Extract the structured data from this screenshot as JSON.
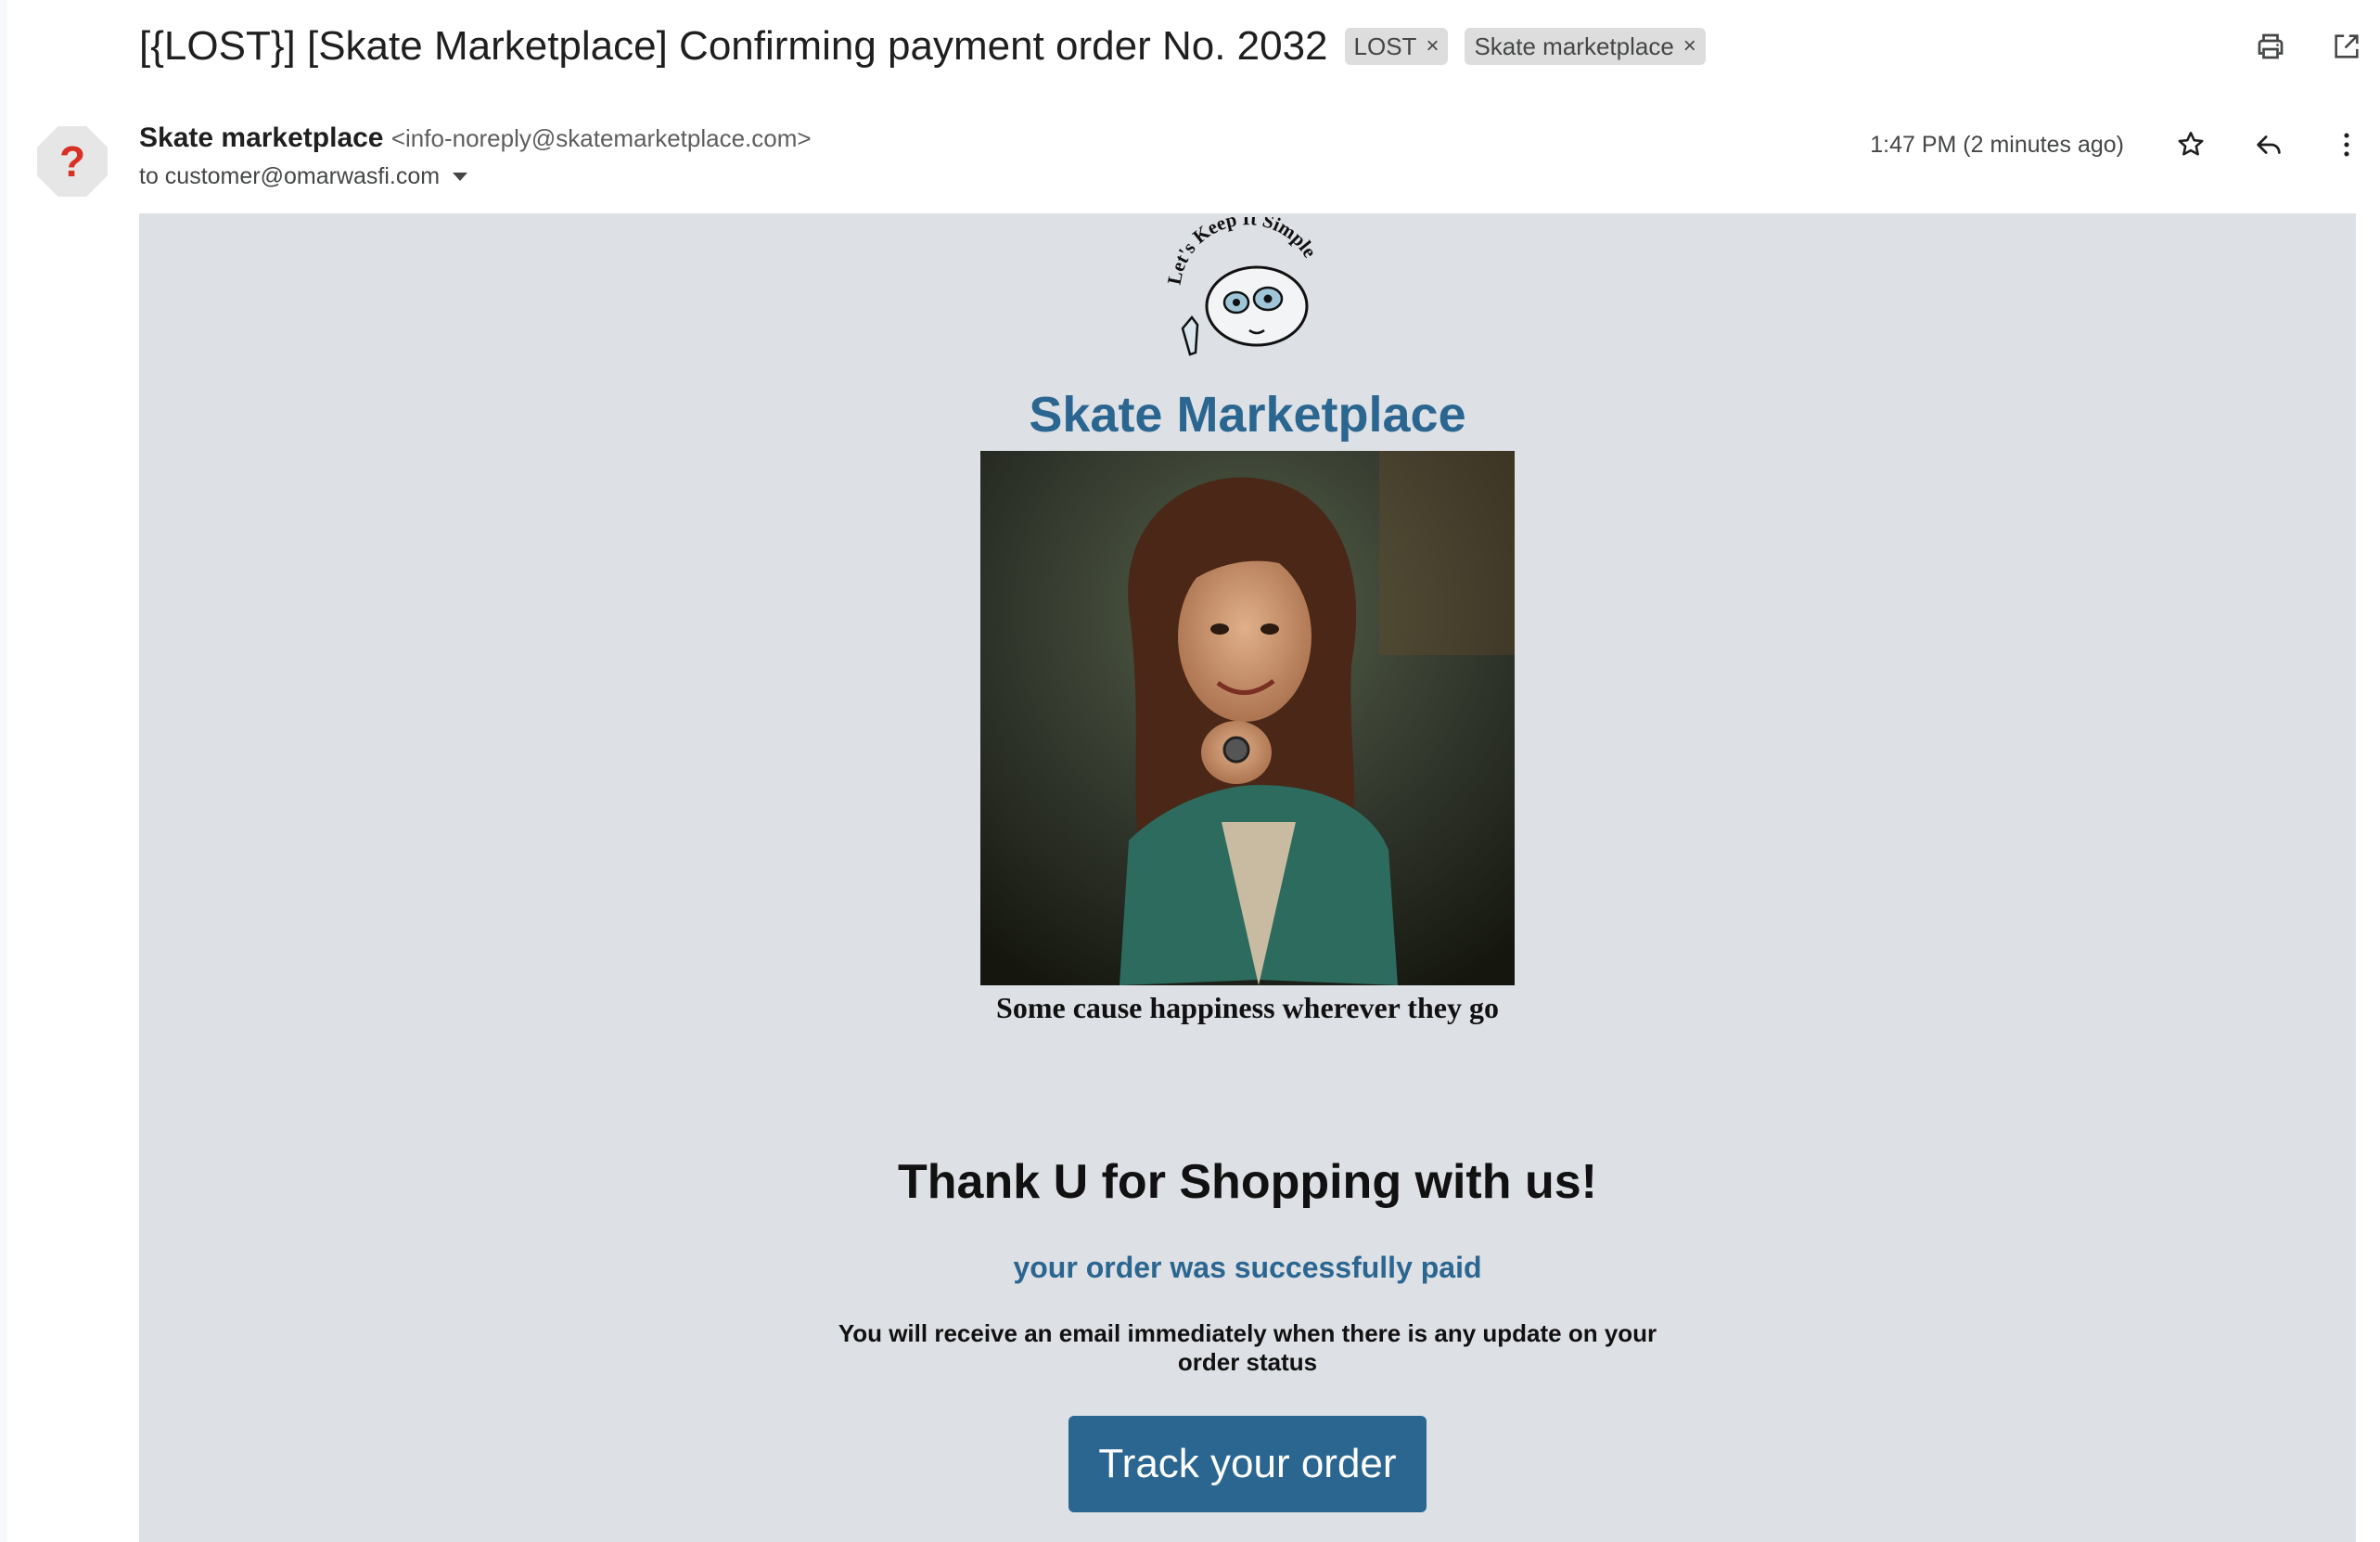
{
  "header": {
    "subject": "[{LOST}] [Skate Marketplace] Confirming payment order No. 2032",
    "labels": [
      {
        "text": "LOST",
        "remove": "×"
      },
      {
        "text": "Skate marketplace",
        "remove": "×"
      }
    ],
    "icons": [
      "print-icon",
      "open-in-new-window-icon"
    ]
  },
  "message": {
    "avatar_symbol": "?",
    "sender_name": "Skate marketplace",
    "sender_email": "<info-noreply@skatemarketplace.com>",
    "to_line": "to customer@omarwasfi.com",
    "time": "1:47 PM (2 minutes ago)",
    "actions": [
      "star-icon",
      "reply-icon",
      "more-options-icon"
    ]
  },
  "email": {
    "logo_text": "Let's Keep It Simple",
    "brand": "Skate Marketplace",
    "caption": "Some cause happiness wherever they go",
    "thanks": "Thank U for Shopping with us!",
    "paid": "your order was successfully paid",
    "update": "You will receive an email immediately when there is any update on your order status",
    "button": "Track your order"
  },
  "colors": {
    "accent": "#2b6690",
    "body_bg": "#dde0e5",
    "avatar_mark": "#d93025",
    "chip_bg": "#dddddd"
  }
}
